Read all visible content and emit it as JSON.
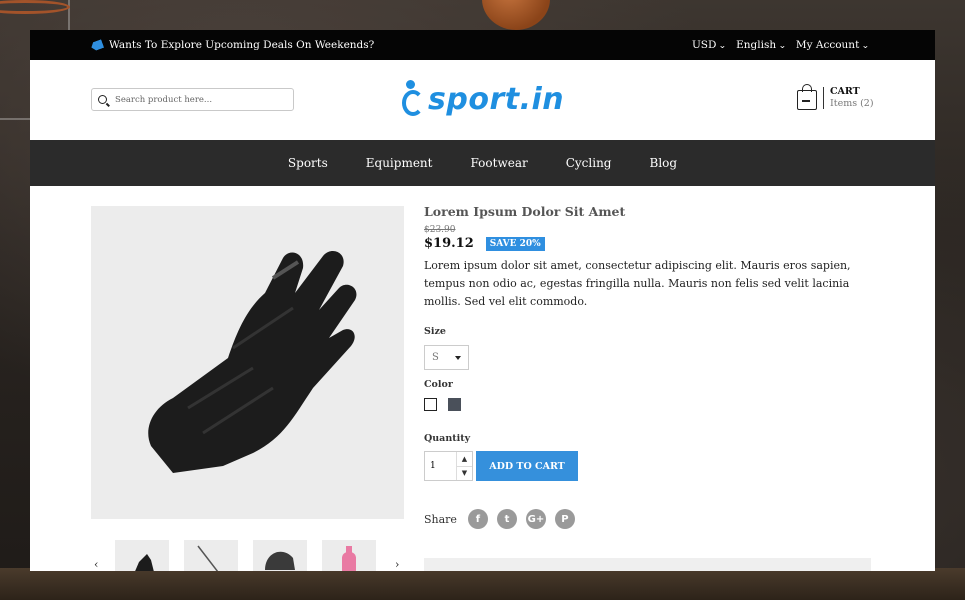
{
  "topbar": {
    "promo": "Wants To Explore Upcoming Deals On Weekends?",
    "currency": "USD",
    "language": "English",
    "account": "My Account"
  },
  "search": {
    "placeholder": "Search product here..."
  },
  "logo": {
    "text": "sport.in"
  },
  "cart": {
    "title": "CART",
    "items": "Items (2)"
  },
  "nav": {
    "items": [
      "Sports",
      "Equipment",
      "Footwear",
      "Cycling",
      "Blog"
    ]
  },
  "product": {
    "title": "Lorem Ipsum Dolor Sit Amet",
    "old_price": "$23.90",
    "price": "$19.12",
    "save_badge": "SAVE 20%",
    "description": "Lorem ipsum dolor sit amet, consectetur adipiscing elit. Mauris eros sapien, tempus non odio ac, egestas fringilla nulla. Mauris non felis sed velit lacinia mollis. Sed vel elit commodo.",
    "size_label": "Size",
    "size_value": "S",
    "color_label": "Color",
    "colors": [
      "#ffffff",
      "#4a505a"
    ],
    "quantity_label": "Quantity",
    "quantity_value": "1",
    "add_to_cart": "ADD TO CART",
    "share_label": "Share",
    "social_icons": [
      "facebook-icon",
      "twitter-icon",
      "google-plus-icon",
      "pinterest-icon"
    ]
  },
  "colors": {
    "accent": "#2f8fe0",
    "nav_bg": "#2b2b2b",
    "topbar_bg": "#050505"
  }
}
